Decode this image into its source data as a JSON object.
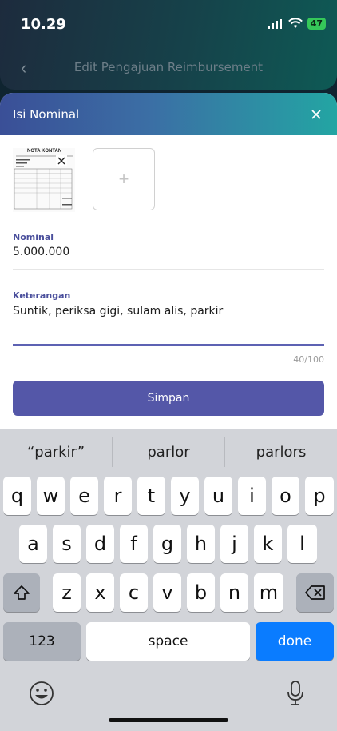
{
  "status_bar": {
    "time": "10.29",
    "battery": "47"
  },
  "background_screen": {
    "title": "Edit  Pengajuan Reimbursement"
  },
  "sheet": {
    "title": "Isi Nominal",
    "receipt_title": "NOTA KONTAN",
    "nominal": {
      "label": "Nominal",
      "value": "5.000.000"
    },
    "keterangan": {
      "label": "Keterangan",
      "value": "Suntik, periksa gigi, sulam alis, parkir",
      "counter": "40/100"
    },
    "save_label": "Simpan"
  },
  "keyboard": {
    "suggestions": [
      "“parkir”",
      "parlor",
      "parlors"
    ],
    "row1": [
      "q",
      "w",
      "e",
      "r",
      "t",
      "y",
      "u",
      "i",
      "o",
      "p"
    ],
    "row2": [
      "a",
      "s",
      "d",
      "f",
      "g",
      "h",
      "j",
      "k",
      "l"
    ],
    "row3": [
      "z",
      "x",
      "c",
      "v",
      "b",
      "n",
      "m"
    ],
    "numbers_label": "123",
    "space_label": "space",
    "done_label": "done"
  },
  "colors": {
    "accent": "#5457a8",
    "keyboard_done": "#0a7cff"
  }
}
